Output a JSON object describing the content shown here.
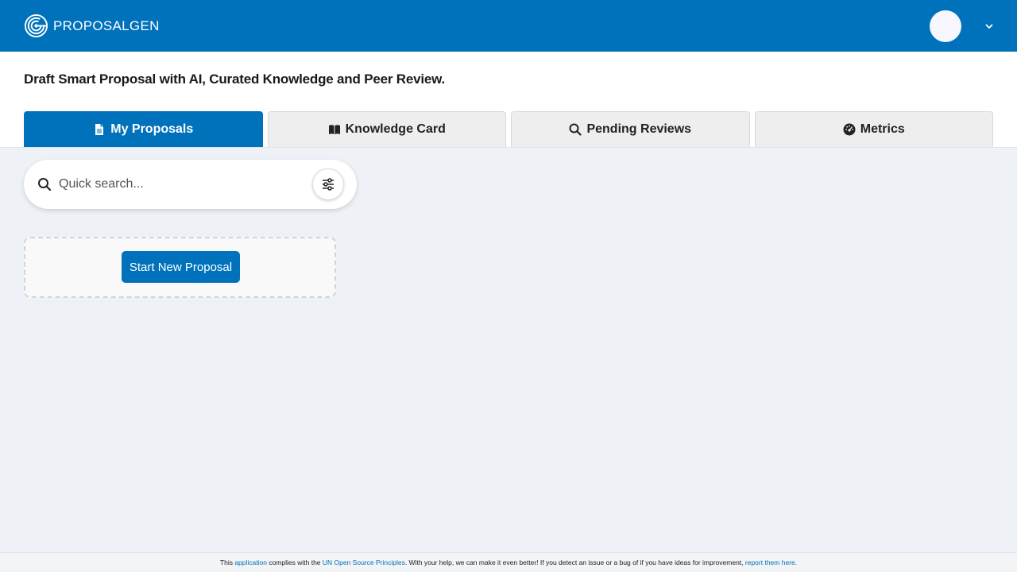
{
  "app": {
    "name": "PROPOSALGEN",
    "tagline": "Draft Smart Proposal with AI, Curated Knowledge and Peer Review."
  },
  "tabs": [
    {
      "label": "My Proposals",
      "icon": "file-icon",
      "active": true
    },
    {
      "label": "Knowledge Card",
      "icon": "book-icon",
      "active": false
    },
    {
      "label": "Pending Reviews",
      "icon": "search-icon",
      "active": false
    },
    {
      "label": "Metrics",
      "icon": "dashboard-icon",
      "active": false
    }
  ],
  "search": {
    "placeholder": "Quick search..."
  },
  "proposals": {
    "start_label": "Start New Proposal"
  },
  "footer": {
    "prefix": "This ",
    "application_link": "application",
    "middle": " complies with the ",
    "principles_link": "UN Open Source Principles",
    "text": ". With your help, we can make it even better! If you detect an issue or a bug of if you have ideas for improvement, ",
    "report_link": "report them here."
  },
  "colors": {
    "brand": "#0072bc",
    "background": "#eef2f7"
  }
}
